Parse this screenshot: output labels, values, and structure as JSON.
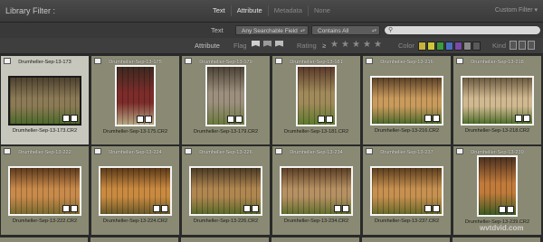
{
  "header": {
    "title": "Library Filter :",
    "modes": [
      {
        "label": "Text",
        "active": true
      },
      {
        "label": "Attribute",
        "active": true
      },
      {
        "label": "Metadata",
        "active": false
      },
      {
        "label": "None",
        "active": false
      }
    ],
    "custom_filter": "Custom Filter ▾"
  },
  "text_row": {
    "label": "Text",
    "field_select": "Any Searchable Field",
    "rule_select": "Contains All",
    "arrows": "▴▾",
    "search_value": ""
  },
  "attribute_row": {
    "label": "Attribute",
    "flag_label": "Flag",
    "rating_label": "Rating",
    "rating_op": "≥",
    "stars": [
      "★",
      "★",
      "★",
      "★",
      "★"
    ],
    "color_label": "Color",
    "colors": [
      "#c8b23a",
      "#cfc73a",
      "#3d9a3d",
      "#4b6fc0",
      "#7a4aa8",
      "#8a8a8a",
      "#5a5a5a"
    ],
    "kind_label": "Kind"
  },
  "grid": {
    "cells": [
      {
        "name": "Drumheller-Sep-13-173",
        "caption": "Drumheller-Sep-13-173.CR2",
        "selected": true
      },
      {
        "name": "Drumheller-Sep-13-175",
        "caption": "Drumheller-Sep-13-175.CR2",
        "selected": false
      },
      {
        "name": "Drumheller-Sep-13-179",
        "caption": "Drumheller-Sep-13-179.CR2",
        "selected": false
      },
      {
        "name": "Drumheller-Sep-13-181",
        "caption": "Drumheller-Sep-13-181.CR2",
        "selected": false
      },
      {
        "name": "Drumheller-Sep-13-216",
        "caption": "Drumheller-Sep-13-216.CR2",
        "selected": false
      },
      {
        "name": "Drumheller-Sep-13-218",
        "caption": "Drumheller-Sep-13-218.CR2",
        "selected": false
      },
      {
        "name": "Drumheller-Sep-13-222",
        "caption": "Drumheller-Sep-13-222.CR2",
        "selected": false
      },
      {
        "name": "Drumheller-Sep-13-224",
        "caption": "Drumheller-Sep-13-224.CR2",
        "selected": false
      },
      {
        "name": "Drumheller-Sep-13-226",
        "caption": "Drumheller-Sep-13-226.CR2",
        "selected": false
      },
      {
        "name": "Drumheller-Sep-13-234",
        "caption": "Drumheller-Sep-13-234.CR2",
        "selected": false
      },
      {
        "name": "Drumheller-Sep-13-237",
        "caption": "Drumheller-Sep-13-237.CR2",
        "selected": false
      },
      {
        "name": "Drumheller-Sep-13-239",
        "caption": "Drumheller-Sep-13-239.CR2",
        "selected": false
      }
    ]
  },
  "watermark": "wvtdvid.com"
}
